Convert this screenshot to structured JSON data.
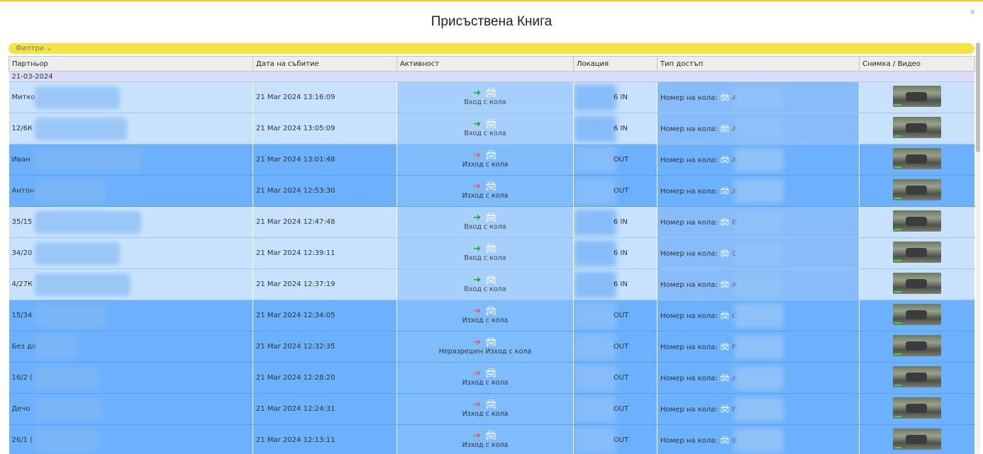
{
  "header": {
    "title": "Присъствена Книга",
    "close": "×"
  },
  "filters": {
    "label": "Филтри ⌄"
  },
  "columns": [
    "Партньор",
    "Дата на събитие",
    "Активност",
    "Локация",
    "Тип достъп",
    "Снимка / Видео"
  ],
  "group_date": "21-03-2024",
  "rows": [
    {
      "partner": "Митко",
      "date": "21 Mar 2024 13:16:09",
      "direction": "in",
      "activity": "Вход с кола",
      "location": "6 IN",
      "access_label": "Номер на кола:",
      "plate": "А"
    },
    {
      "partner": "12/6К",
      "date": "21 Mar 2024 13:05:09",
      "direction": "in",
      "activity": "Вход с кола",
      "location": "6 IN",
      "access_label": "Номер на кола:",
      "plate": "А"
    },
    {
      "partner": "Иван",
      "date": "21 Mar 2024 13:01:48",
      "direction": "out",
      "activity": "Изход с кола",
      "location": "OUT",
      "access_label": "Номер на кола:",
      "plate": "А"
    },
    {
      "partner": "Антон",
      "date": "21 Mar 2024 12:53:30",
      "direction": "out",
      "activity": "Изход с кола",
      "location": "OUT",
      "access_label": "Номер на кола:",
      "plate": "А"
    },
    {
      "partner": "35/15",
      "date": "21 Mar 2024 12:47:48",
      "direction": "in",
      "activity": "Вход с кола",
      "location": "6 IN",
      "access_label": "Номер на кола:",
      "plate": "В"
    },
    {
      "partner": "34/20",
      "date": "21 Mar 2024 12:39:11",
      "direction": "in",
      "activity": "Вход с кола",
      "location": "6 IN",
      "access_label": "Номер на кола:",
      "plate": "С"
    },
    {
      "partner": "4/27К",
      "date": "21 Mar 2024 12:37:19",
      "direction": "in",
      "activity": "Вход с кола",
      "location": "6 IN",
      "access_label": "Номер на кола:",
      "plate": "А"
    },
    {
      "partner": "15/34",
      "date": "21 Mar 2024 12:34:05",
      "direction": "out",
      "activity": "Изход с кола",
      "location": "OUT",
      "access_label": "Номер на кола:",
      "plate": "С"
    },
    {
      "partner": "Без до",
      "date": "21 Mar 2024 12:32:35",
      "direction": "out",
      "activity": "Неразрешен Изход с кола",
      "location": "OUT",
      "access_label": "Номер на кола:",
      "plate": "Р"
    },
    {
      "partner": "16/2 (",
      "date": "21 Mar 2024 12:28:20",
      "direction": "out",
      "activity": "Изход с кола",
      "location": "OUT",
      "access_label": "Номер на кола:",
      "plate": "А"
    },
    {
      "partner": "Дечо",
      "date": "21 Mar 2024 12:24:31",
      "direction": "out",
      "activity": "Изход с кола",
      "location": "OUT",
      "access_label": "Номер на кола:",
      "plate": "Р"
    },
    {
      "partner": "26/1 (",
      "date": "21 Mar 2024 12:13:11",
      "direction": "out",
      "activity": "Изход с кола",
      "location": "OUT",
      "access_label": "Номер на кола:",
      "plate": "В"
    }
  ],
  "icons": {
    "enter": "sign-in-icon",
    "exit": "sign-out-icon",
    "car": "car-icon",
    "photo": "photo-thumbnail"
  },
  "colors": {
    "accent": "#f6c819",
    "row_in": "#c8e2fd",
    "row_out": "#6cb1fb",
    "enter_icon": "#1bb11b",
    "exit_icon": "#e36161"
  }
}
